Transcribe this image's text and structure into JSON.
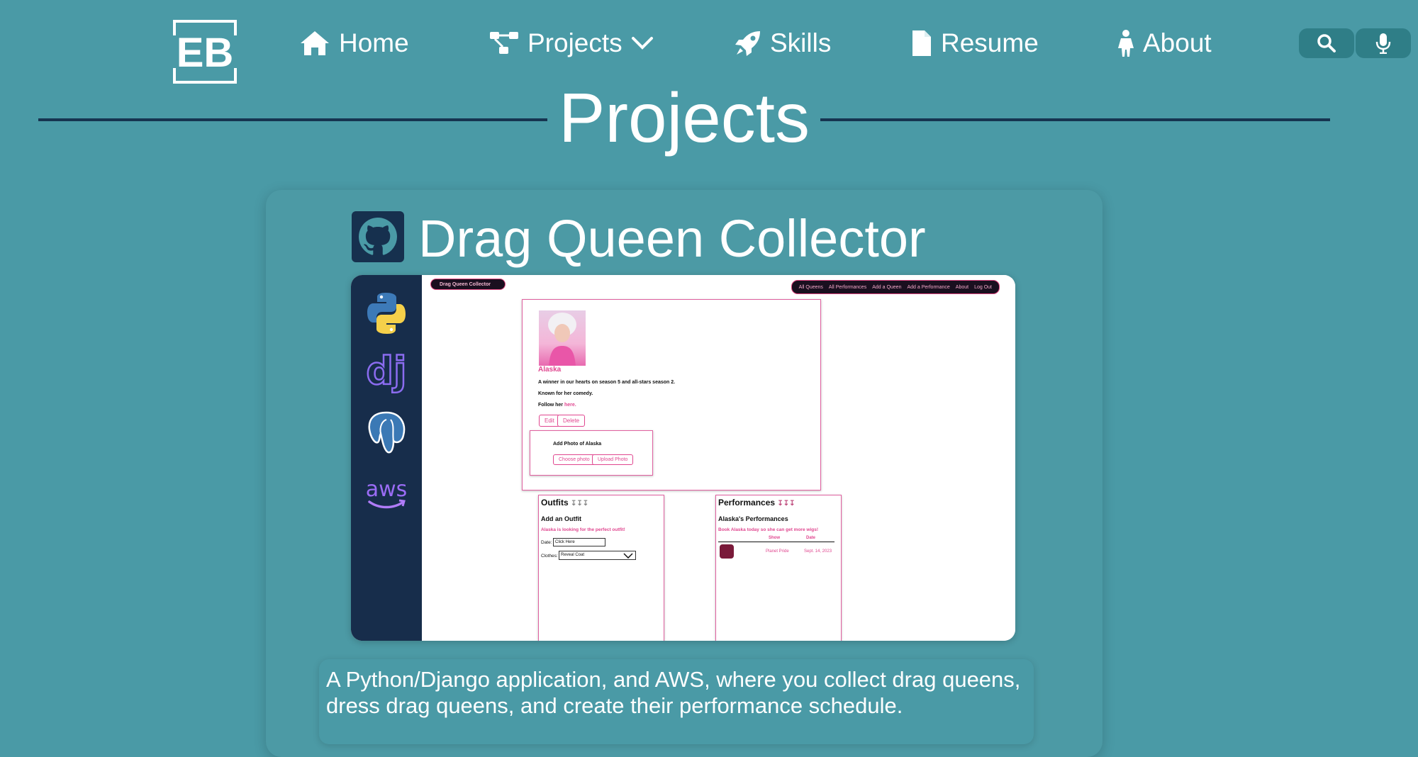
{
  "nav": {
    "logo_text": "EB",
    "items": [
      {
        "label": "Home",
        "icon": "home-icon"
      },
      {
        "label": "Projects",
        "icon": "project-diagram-icon"
      },
      {
        "label": "Skills",
        "icon": "rocket-icon"
      },
      {
        "label": "Resume",
        "icon": "file-icon"
      },
      {
        "label": "About",
        "icon": "person-icon"
      }
    ],
    "search_icon": "search-icon",
    "mic_icon": "microphone-icon"
  },
  "page": {
    "title": "Projects"
  },
  "project": {
    "title": "Drag Queen Collector",
    "github_icon": "github-icon",
    "tech_icons": [
      "python-icon",
      "django-icon",
      "postgresql-icon",
      "aws-icon"
    ],
    "description": "A Python/Django application, and AWS, where you collect drag queens, dress drag queens, and create their performance schedule.",
    "screenshot": {
      "brand": "Drag Queen Collector",
      "nav": [
        "All Queens",
        "All Performances",
        "Add a Queen",
        "Add a Performance",
        "About",
        "Log Out"
      ],
      "queen_name": "Alaska",
      "line1": "A winner in our hearts on season 5 and all-stars season 2.",
      "line2": "Known for her comedy.",
      "follow_prefix": "Follow her ",
      "follow_link": "here.",
      "edit_btn": "Edit",
      "delete_btn": "Delete",
      "add_photo": "Add Photo of Alaska",
      "choose_photo": "Choose photo",
      "upload_photo": "Upload Photo",
      "outfits_heading": "Outfits",
      "add_outfit": "Add an Outfit",
      "outfit_tagline": "Alaska is looking for the perfect outfit!",
      "date_label": "Date:",
      "date_value": "Click Here",
      "clothes_label": "Clothes:",
      "clothes_value": "Reveal Coat",
      "performances_heading": "Performances",
      "alaskas_performances": "Alaska's Performances",
      "perf_tagline": "Book Alaska today so she can get more wigs!",
      "col_show": "Show",
      "col_date": "Date",
      "row_show": "Planet Pride",
      "row_date": "Sept. 14, 2023"
    }
  },
  "colors": {
    "background": "#4a9aa6",
    "navy": "#172d4b",
    "pink": "#e0468f"
  }
}
